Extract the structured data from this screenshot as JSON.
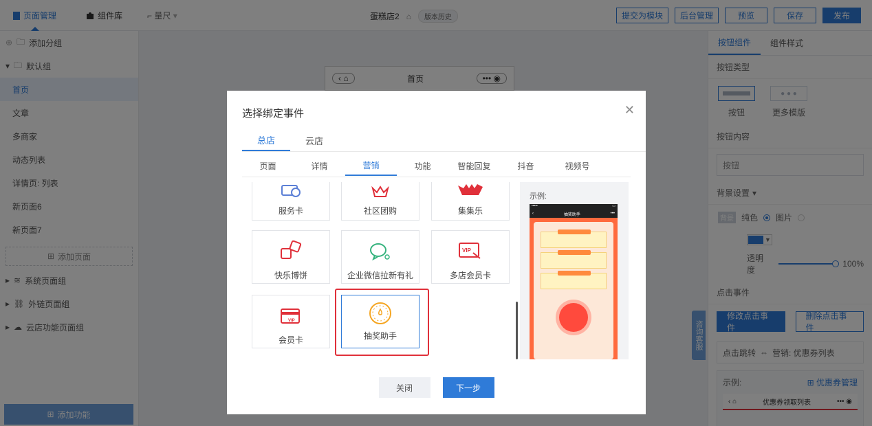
{
  "topbar": {
    "tabs": [
      {
        "label": "页面管理",
        "icon": "page-icon"
      },
      {
        "label": "组件库",
        "icon": "puzzle-icon"
      }
    ],
    "ruler": "量尺",
    "page_name": "蛋糕店2",
    "version_label": "版本历史",
    "actions": [
      "提交为模块",
      "后台管理",
      "预览",
      "保存",
      "发布"
    ]
  },
  "sidebar": {
    "add_group": "添加分组",
    "default_group": "默认组",
    "pages": [
      "首页",
      "文章",
      "多商家",
      "动态列表",
      "详情页: 列表",
      "新页面6",
      "新页面7"
    ],
    "add_page": "添加页面",
    "groups": [
      "系统页面组",
      "外链页面组",
      "云店功能页面组"
    ],
    "add_function": "添加功能"
  },
  "canvas": {
    "phone_title": "首页"
  },
  "right_panel": {
    "tabs": [
      "按钮组件",
      "组件样式"
    ],
    "button_type_label": "按钮类型",
    "button_types": [
      "按钮",
      "更多模版"
    ],
    "button_content_label": "按钮内容",
    "button_content_value": "按钮",
    "bg_label": "背景设置",
    "bg_tag": "背景",
    "bg_options": [
      "纯色",
      "图片"
    ],
    "opacity_label": "透明度",
    "opacity_value": "100%",
    "opacity": 1.0,
    "click_event_label": "点击事件",
    "modify_event": "修改点击事件",
    "delete_event": "删除点击事件",
    "jump_prefix": "点击跳转",
    "jump_target": "营销: 优惠券列表",
    "example_label": "示例:",
    "coupon_manage": "优惠券管理",
    "mini_title": "优惠券领取列表",
    "service": "咨询客服"
  },
  "modal": {
    "title": "选择绑定事件",
    "store_tabs": [
      "总店",
      "云店"
    ],
    "category_tabs": [
      "页面",
      "详情",
      "营销",
      "功能",
      "智能回复",
      "抖音",
      "视频号"
    ],
    "cards": [
      {
        "label": "服务卡",
        "icon": "service-card-icon"
      },
      {
        "label": "社区团购",
        "icon": "crown-icon"
      },
      {
        "label": "集集乐",
        "icon": "collect-icon"
      },
      {
        "label": "快乐博饼",
        "icon": "dice-icon"
      },
      {
        "label": "企业微信拉新有礼",
        "icon": "wechat-work-icon"
      },
      {
        "label": "多店会员卡",
        "icon": "vip-card-icon"
      },
      {
        "label": "会员卡",
        "icon": "member-card-icon"
      },
      {
        "label": "抽奖助手",
        "icon": "lottery-icon"
      }
    ],
    "preview_label": "示例:",
    "preview_app_title": "抽奖助手",
    "close_button": "关闭",
    "next_button": "下一步"
  },
  "colors": {
    "accent": "#2f7bd8",
    "highlight": "#e0303a"
  }
}
